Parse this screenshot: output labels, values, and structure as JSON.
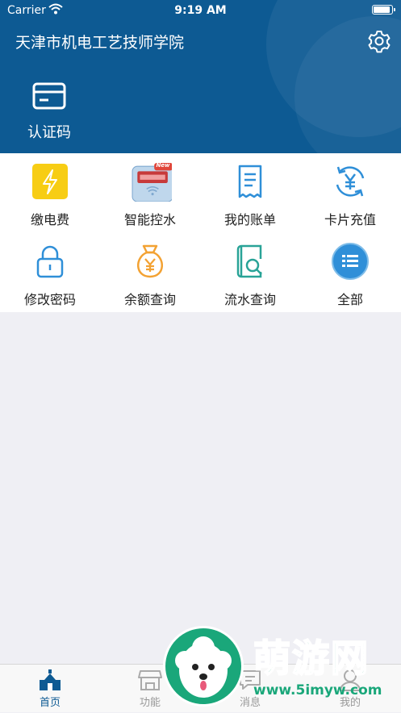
{
  "status_bar": {
    "carrier": "Carrier",
    "time": "9:19 AM"
  },
  "header": {
    "title": "天津市机电工艺技师学院",
    "auth_label": "认证码"
  },
  "grid": {
    "items": [
      {
        "label": "缴电费",
        "icon": "lightning-icon"
      },
      {
        "label": "智能控水",
        "icon": "water-meter-icon",
        "badge": "New"
      },
      {
        "label": "我的账单",
        "icon": "bill-icon"
      },
      {
        "label": "卡片充值",
        "icon": "recharge-icon"
      },
      {
        "label": "修改密码",
        "icon": "lock-icon"
      },
      {
        "label": "余额查询",
        "icon": "money-bag-icon"
      },
      {
        "label": "流水查询",
        "icon": "search-record-icon"
      },
      {
        "label": "全部",
        "icon": "list-icon"
      }
    ]
  },
  "tabbar": {
    "items": [
      {
        "label": "首页",
        "icon": "home-icon",
        "active": true
      },
      {
        "label": "功能",
        "icon": "store-icon",
        "active": false
      },
      {
        "label": "消息",
        "icon": "message-icon",
        "active": false
      },
      {
        "label": "我的",
        "icon": "profile-icon",
        "active": false
      }
    ]
  },
  "watermark": {
    "brand": "萌游网",
    "url": "www.5imyw.com"
  },
  "colors": {
    "header": "#0d5a93",
    "accent_blue": "#2f8fd8",
    "accent_orange": "#f3a233",
    "accent_teal": "#29a397",
    "yellow": "#f7cd14",
    "watermark_green": "#1aa77a"
  }
}
